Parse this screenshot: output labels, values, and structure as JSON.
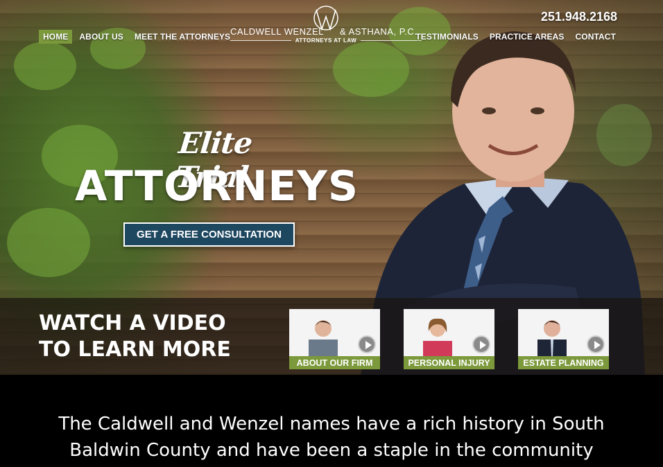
{
  "header": {
    "phone": "251.948.2168",
    "nav_left": [
      {
        "label": "HOME",
        "active": true
      },
      {
        "label": "ABOUT US"
      },
      {
        "label": "MEET THE ATTORNEYS"
      }
    ],
    "nav_right": [
      {
        "label": "TESTIMONIALS"
      },
      {
        "label": "PRACTICE AREAS"
      },
      {
        "label": "CONTACT"
      }
    ],
    "logo": {
      "name_left": "CALDWELL WENZEL",
      "name_right": "& ASTHANA, P.C.",
      "subtitle": "ATTORNEYS AT LAW"
    }
  },
  "hero": {
    "script_title": "Elite Trial",
    "main_title": "ATTORNEYS",
    "cta_label": "GET A FREE CONSULTATION"
  },
  "video": {
    "heading_line1": "WATCH A VIDEO",
    "heading_line2": "TO LEARN MORE",
    "items": [
      {
        "label": "ABOUT OUR FIRM",
        "icon": "play-icon"
      },
      {
        "label": "PERSONAL INJURY",
        "icon": "play-icon"
      },
      {
        "label": "ESTATE PLANNING",
        "icon": "play-icon"
      }
    ]
  },
  "intro": {
    "text": "The Caldwell and Wenzel names have a rich history in South Baldwin County and have been a staple in the community"
  },
  "colors": {
    "accent_green": "#7c9a3c",
    "cta_blue": "#1e4760"
  }
}
